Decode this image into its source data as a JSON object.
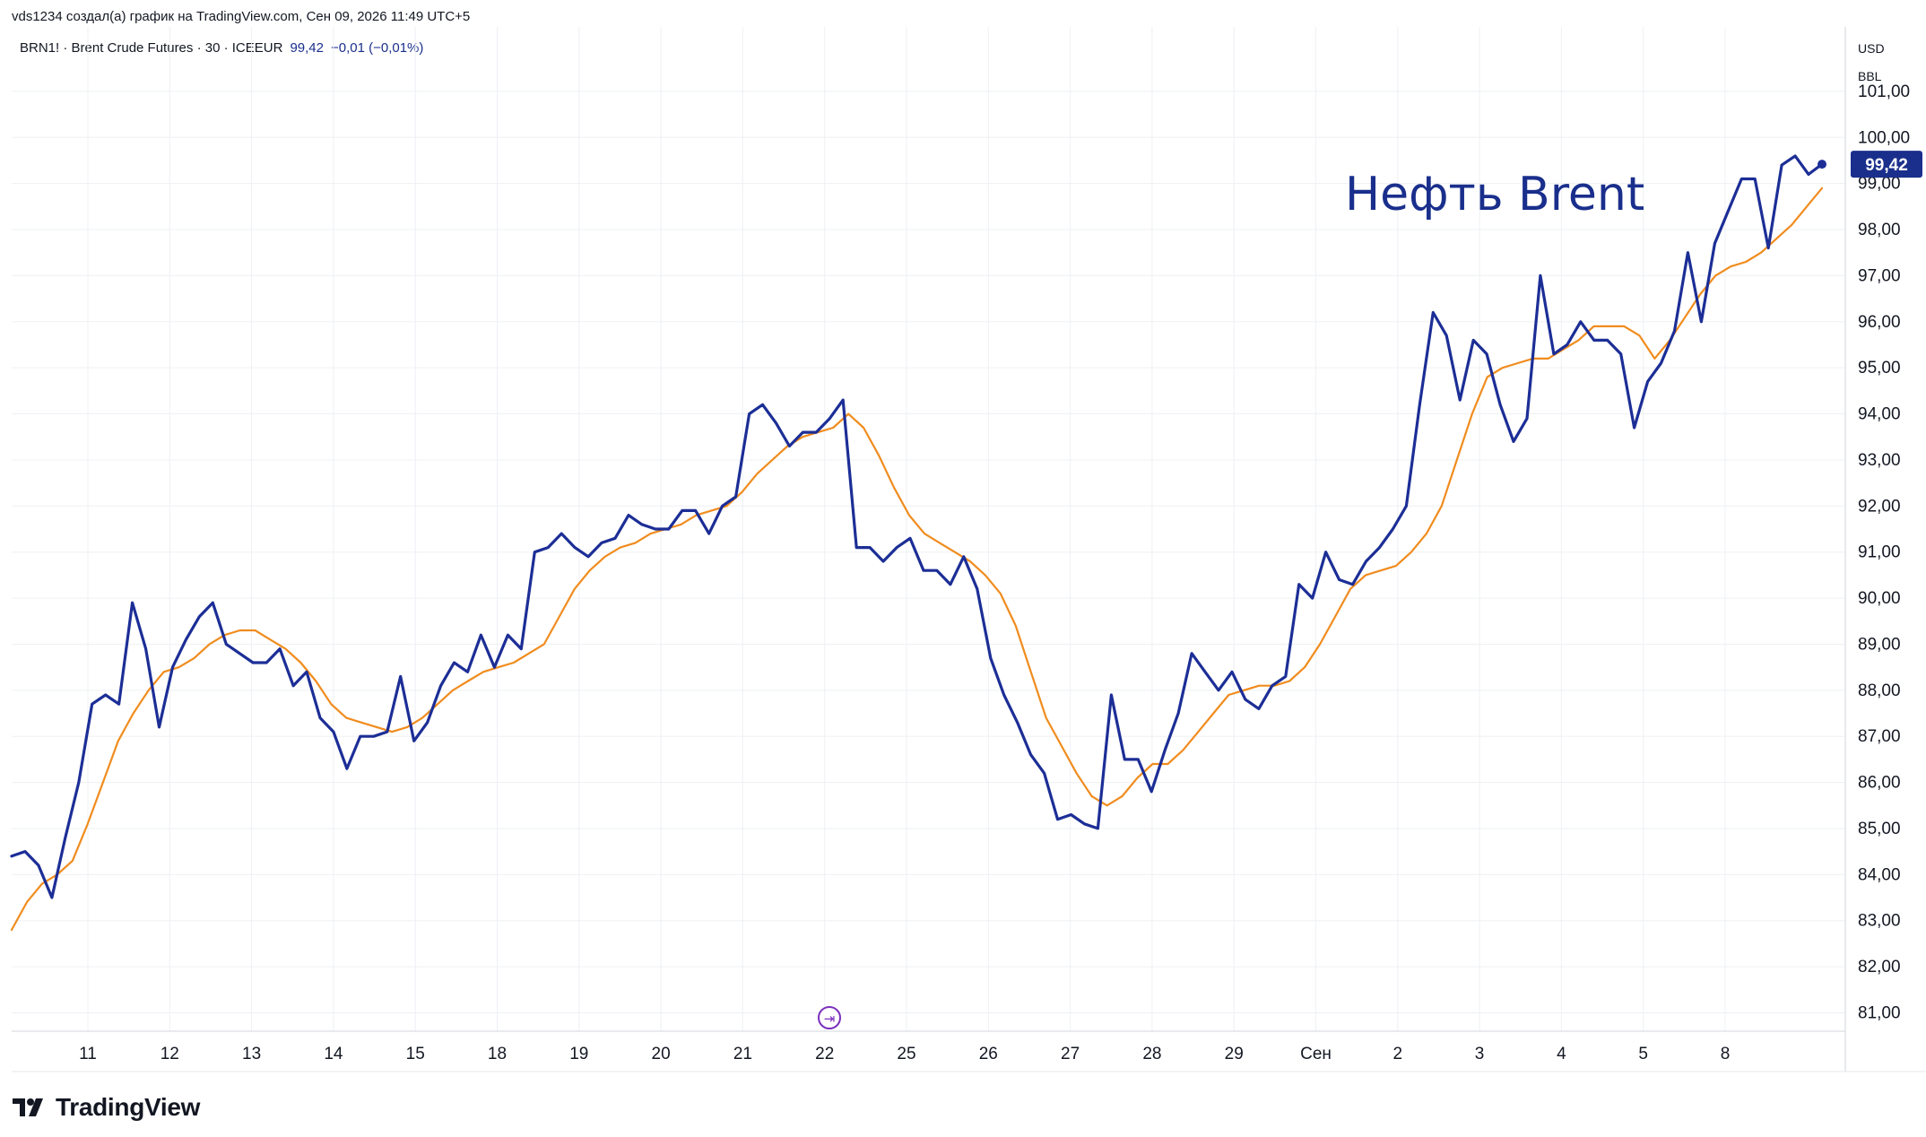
{
  "header": {
    "credit": "vds1234 создал(а) график на TradingView.com, Сен 09, 2026 11:49 UTC+5",
    "symbol": "BRN1! · Brent Crude Futures · 30 · ICEEUR",
    "last_value": "99,42",
    "change": "−0,01 (−0,01%)"
  },
  "price_scale": {
    "currency": "USD",
    "unit": "BBL",
    "last_price_label": "99,42",
    "ticks": [
      "101,00",
      "100,00",
      "99,00",
      "98,00",
      "97,00",
      "96,00",
      "95,00",
      "94,00",
      "93,00",
      "92,00",
      "91,00",
      "90,00",
      "89,00",
      "88,00",
      "87,00",
      "86,00",
      "85,00",
      "84,00",
      "83,00",
      "82,00",
      "81,00"
    ]
  },
  "annotation": "Нефть Brent",
  "footer": {
    "brand": "TradingView"
  },
  "colors": {
    "price_line": "#1c2e96",
    "ma_line": "#f08c1e",
    "grid": "#eef0f4",
    "last_price_bg": "#1a2f8c"
  },
  "chart_data": {
    "type": "line",
    "title": "",
    "xlabel": "",
    "ylabel": "",
    "ylim": [
      80.6,
      102.4
    ],
    "categories": [
      "11",
      "12",
      "13",
      "14",
      "15",
      "18",
      "19",
      "20",
      "21",
      "22",
      "25",
      "26",
      "27",
      "28",
      "29",
      "Сен",
      "2",
      "3",
      "4",
      "5",
      "8"
    ],
    "series": [
      {
        "values": [
          84.4,
          84.5,
          84.2,
          83.5,
          84.8,
          86.0,
          87.7,
          87.9,
          87.7,
          89.9,
          88.9,
          87.2,
          88.5,
          89.1,
          89.6,
          89.9,
          89.0,
          88.8,
          88.6,
          88.6,
          88.9,
          88.1,
          88.4,
          87.4,
          87.1,
          86.3,
          87.0,
          87.0,
          87.1,
          88.3,
          86.9,
          87.3,
          88.1,
          88.6,
          88.4,
          89.2,
          88.5,
          89.2,
          88.9,
          91.0,
          91.1,
          91.4,
          91.1,
          90.9,
          91.2,
          91.3,
          91.8,
          91.6,
          91.5,
          91.5,
          91.9,
          91.9,
          91.4,
          92.0,
          92.2,
          94.0,
          94.2,
          93.8,
          93.3,
          93.6,
          93.6,
          93.9,
          94.3,
          91.1,
          91.1,
          90.8,
          91.1,
          91.3,
          90.6,
          90.6,
          90.3,
          90.9,
          90.2,
          88.7,
          87.9,
          87.3,
          86.6,
          86.2,
          85.2,
          85.3,
          85.1,
          85.0,
          87.9,
          86.5,
          86.5,
          85.8,
          86.7,
          87.5,
          88.8,
          88.4,
          88.0,
          88.4,
          87.8,
          87.6,
          88.1,
          88.3,
          90.3,
          90.0,
          91.0,
          90.4,
          90.3,
          90.8,
          91.1,
          91.5,
          92.0,
          94.2,
          96.2,
          95.7,
          94.3,
          95.6,
          95.3,
          94.2,
          93.4,
          93.9,
          97.0,
          95.3,
          95.5,
          96.0,
          95.6,
          95.6,
          95.3,
          93.7,
          94.7,
          95.1,
          95.8,
          97.5,
          96.0,
          97.7,
          98.4,
          99.1,
          99.1,
          97.6,
          99.4,
          99.6,
          99.2,
          99.42
        ],
        "color": "#1c2e96"
      },
      {
        "values": [
          82.8,
          83.4,
          83.8,
          84.0,
          84.3,
          85.1,
          86.0,
          86.9,
          87.5,
          88.0,
          88.4,
          88.5,
          88.7,
          89.0,
          89.2,
          89.3,
          89.3,
          89.1,
          88.9,
          88.6,
          88.2,
          87.7,
          87.4,
          87.3,
          87.2,
          87.1,
          87.2,
          87.4,
          87.7,
          88.0,
          88.2,
          88.4,
          88.5,
          88.6,
          88.8,
          89.0,
          89.6,
          90.2,
          90.6,
          90.9,
          91.1,
          91.2,
          91.4,
          91.5,
          91.6,
          91.8,
          91.9,
          92.0,
          92.3,
          92.7,
          93.0,
          93.3,
          93.5,
          93.6,
          93.7,
          94.0,
          93.7,
          93.1,
          92.4,
          91.8,
          91.4,
          91.2,
          91.0,
          90.8,
          90.5,
          90.1,
          89.4,
          88.4,
          87.4,
          86.8,
          86.2,
          85.7,
          85.5,
          85.7,
          86.1,
          86.4,
          86.4,
          86.7,
          87.1,
          87.5,
          87.9,
          88.0,
          88.1,
          88.1,
          88.2,
          88.5,
          89.0,
          89.6,
          90.2,
          90.5,
          90.6,
          90.7,
          91.0,
          91.4,
          92.0,
          93.0,
          94.0,
          94.8,
          95.0,
          95.1,
          95.2,
          95.2,
          95.4,
          95.6,
          95.9,
          95.9,
          95.9,
          95.7,
          95.2,
          95.6,
          96.1,
          96.6,
          97.0,
          97.2,
          97.3,
          97.5,
          97.8,
          98.1,
          98.5,
          98.9
        ],
        "color": "#f08c1e"
      }
    ]
  }
}
